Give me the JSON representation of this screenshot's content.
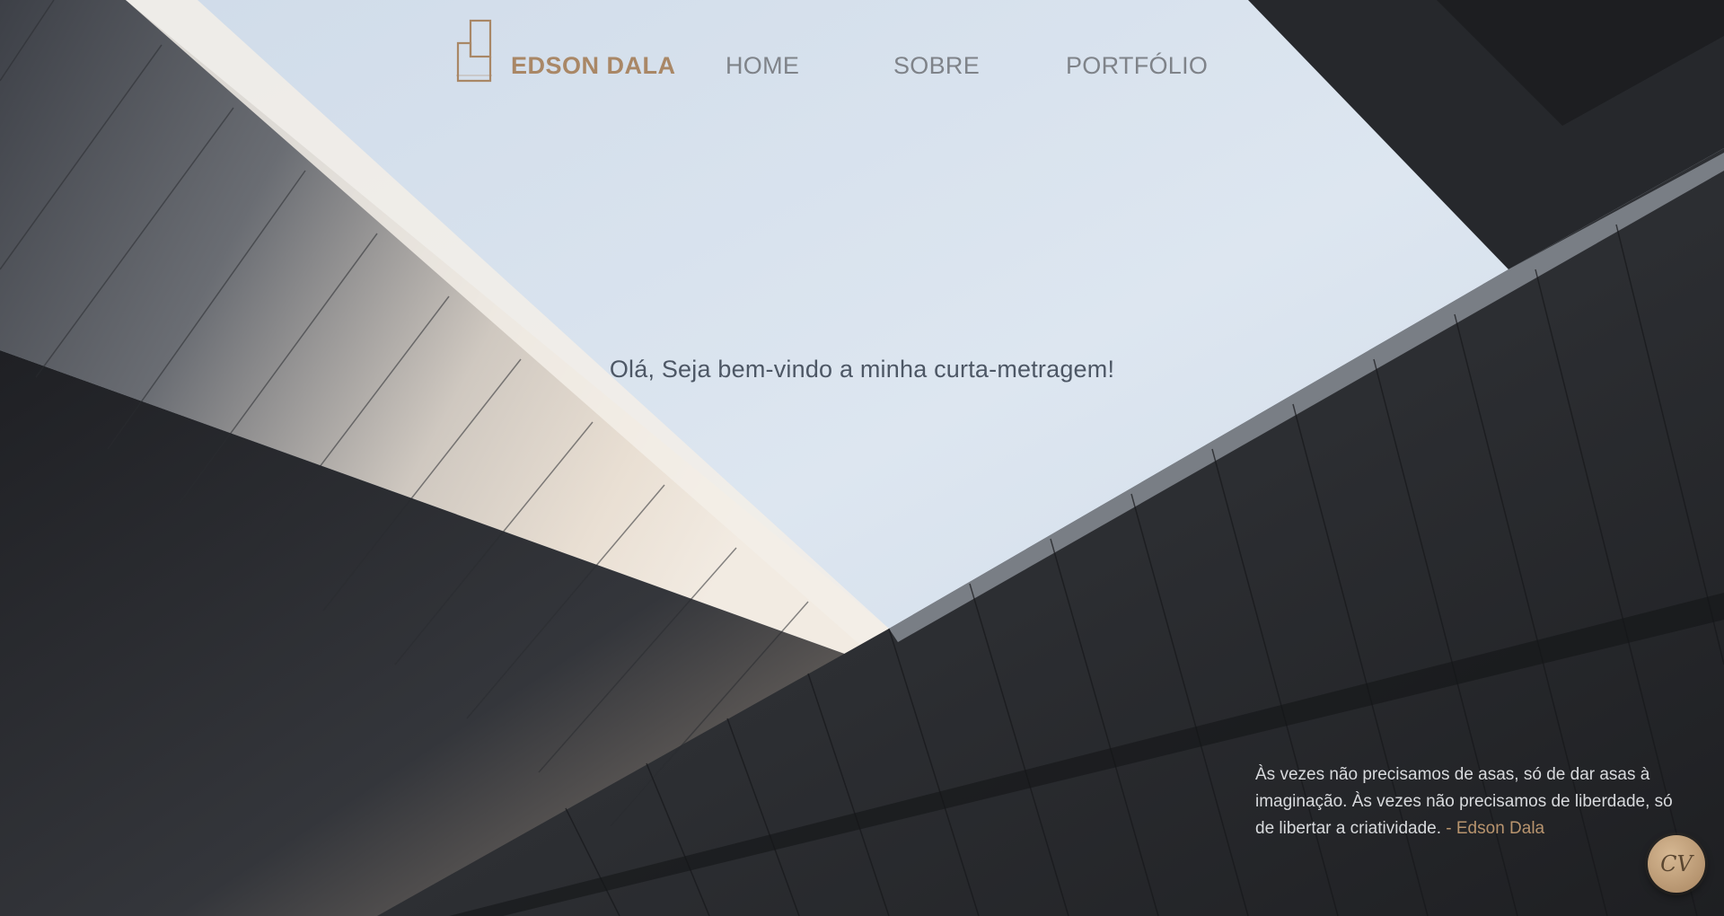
{
  "header": {
    "brand": "EDSON DALA",
    "logo_icon": "ed-monogram-logo-icon",
    "nav": [
      {
        "label": "HOME"
      },
      {
        "label": "SOBRE"
      },
      {
        "label": "PORTFÓLIO"
      }
    ]
  },
  "hero": {
    "greeting": "Olá, Seja bem-vindo a minha curta-metragem!"
  },
  "quote": {
    "text": "Às vezes não precisamos de asas, só de dar asas à imaginação. Às vezes não precisamos de liberdade, só de libertar a criatividade.",
    "author": "- Edson Dala"
  },
  "cv_button": {
    "label": "CV"
  },
  "colors": {
    "accent": "#a98766",
    "nav_text": "#7f8389",
    "sky": "#d9e3ee",
    "building_dark": "#2b2d31"
  }
}
